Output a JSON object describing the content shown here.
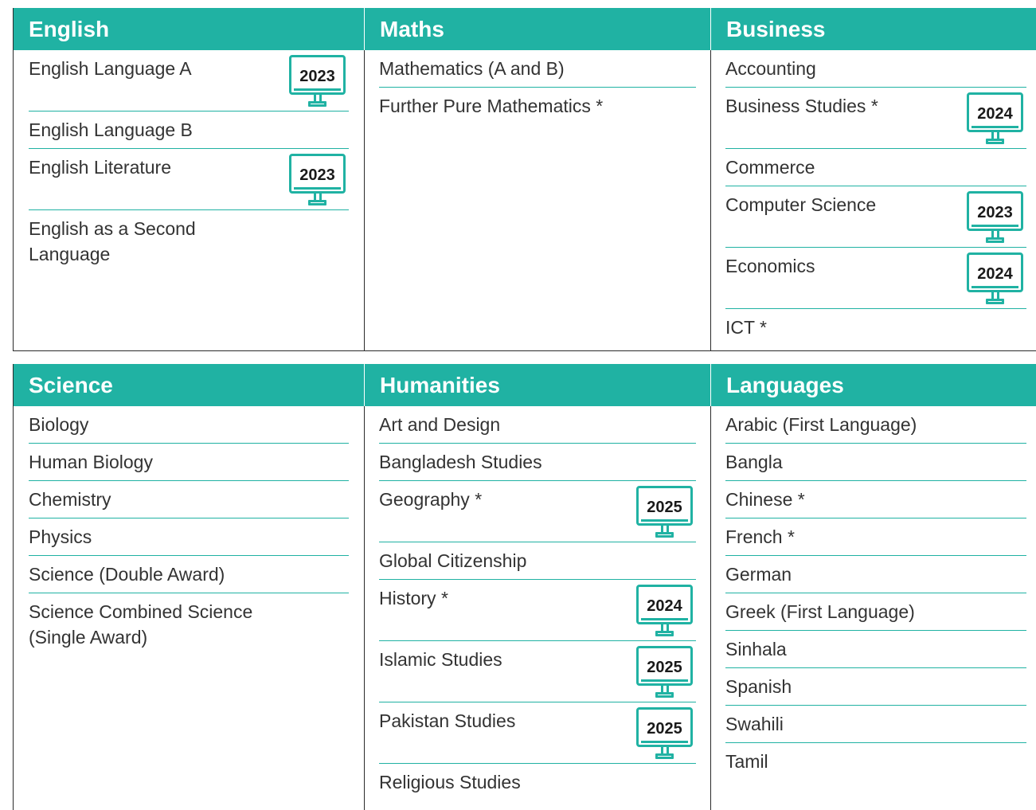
{
  "top": {
    "headers": [
      "English",
      "Maths",
      "Business"
    ],
    "columns": [
      [
        {
          "name": "English Language A",
          "badge": "2023"
        },
        {
          "name": "English Language B"
        },
        {
          "name": "English Literature",
          "badge": "2023"
        },
        {
          "name": "English as a Second\nLanguage"
        }
      ],
      [
        {
          "name": "Mathematics (A and B)"
        },
        {
          "name": "Further Pure Mathematics *"
        }
      ],
      [
        {
          "name": "Accounting"
        },
        {
          "name": "Business Studies *",
          "badge": "2024"
        },
        {
          "name": "Commerce"
        },
        {
          "name": "Computer Science",
          "badge": "2023"
        },
        {
          "name": "Economics",
          "badge": "2024"
        },
        {
          "name": "ICT *"
        }
      ]
    ]
  },
  "bottom": {
    "headers": [
      "Science",
      "Humanities",
      "Languages"
    ],
    "columns": [
      [
        {
          "name": "Biology"
        },
        {
          "name": "Human Biology"
        },
        {
          "name": "Chemistry"
        },
        {
          "name": "Physics"
        },
        {
          "name": "Science (Double Award)"
        },
        {
          "name": "Science Combined Science\n(Single Award)"
        }
      ],
      [
        {
          "name": "Art and Design"
        },
        {
          "name": "Bangladesh Studies"
        },
        {
          "name": "Geography *",
          "badge": "2025"
        },
        {
          "name": "Global Citizenship"
        },
        {
          "name": "History *",
          "badge": "2024"
        },
        {
          "name": "Islamic Studies",
          "badge": "2025"
        },
        {
          "name": "Pakistan Studies",
          "badge": "2025"
        },
        {
          "name": "Religious Studies"
        }
      ],
      [
        {
          "name": "Arabic (First Language)"
        },
        {
          "name": "Bangla"
        },
        {
          "name": "Chinese *"
        },
        {
          "name": "French *"
        },
        {
          "name": "German"
        },
        {
          "name": "Greek (First Language)"
        },
        {
          "name": "Sinhala"
        },
        {
          "name": "Spanish"
        },
        {
          "name": "Swahili"
        },
        {
          "name": "Tamil"
        }
      ]
    ]
  },
  "colors": {
    "accent": "#20b2a3",
    "border": "#2a2a2a",
    "text": "#333333"
  },
  "icon": "monitor-icon"
}
